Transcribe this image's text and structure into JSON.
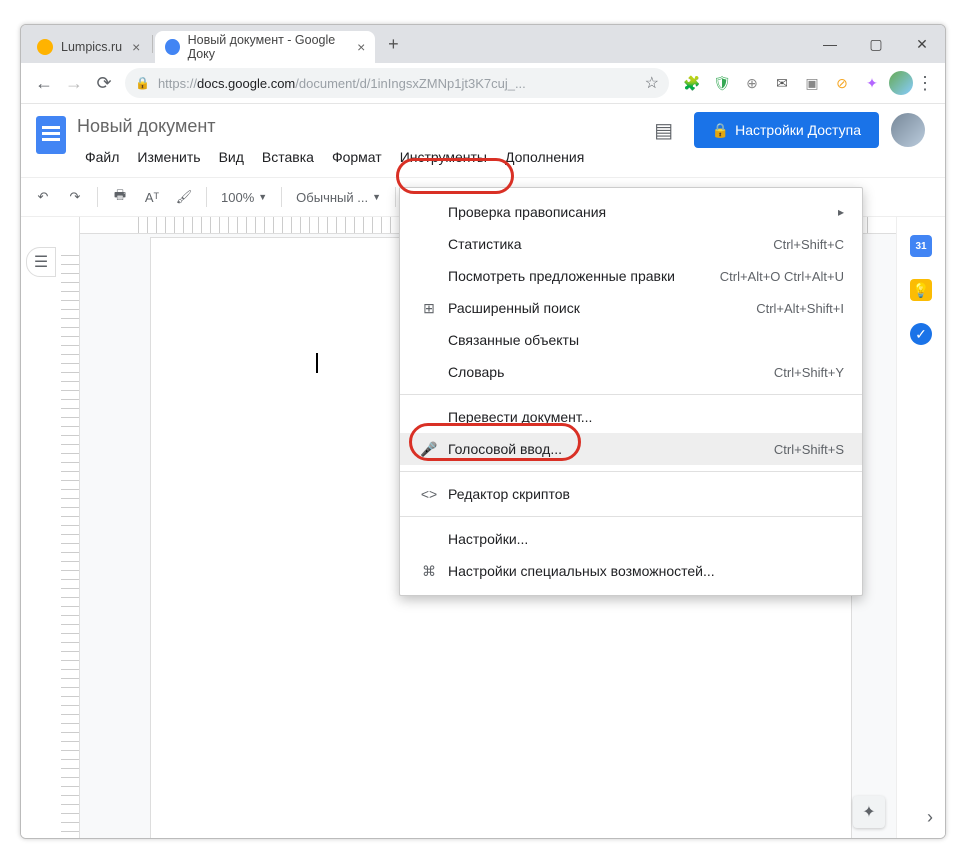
{
  "browser": {
    "tabs": [
      {
        "title": "Lumpics.ru",
        "icon_color": "#ffb300",
        "active": false
      },
      {
        "title": "Новый документ - Google Доку",
        "icon_color": "#4285f4",
        "active": true
      }
    ],
    "url_https": "https://",
    "url_host": "docs.google.com",
    "url_path": "/document/d/1inIngsxZMNp1jt3K7cuj_...",
    "address_buttons": {
      "back": "←",
      "forward": "→",
      "reload": "⟳"
    },
    "extensions": [
      "🧩",
      "🛡",
      "⊕",
      "✉",
      "▣",
      "⊘",
      "✦"
    ]
  },
  "docs": {
    "title": "Новый документ",
    "menus": [
      "Файл",
      "Изменить",
      "Вид",
      "Вставка",
      "Формат",
      "Инструменты",
      "Дополнения"
    ],
    "highlighted_menu_index": 5,
    "share_label": "Настройки Доступа",
    "toolbar": {
      "zoom": "100%",
      "style": "Обычный ..."
    }
  },
  "sidebar": {
    "calendar": "31"
  },
  "dropdown": {
    "items": [
      {
        "icon": "",
        "label": "Проверка правописания",
        "shortcut": "",
        "arrow": true
      },
      {
        "icon": "",
        "label": "Статистика",
        "shortcut": "Ctrl+Shift+C"
      },
      {
        "icon": "",
        "label": "Посмотреть предложенные правки",
        "shortcut": "Ctrl+Alt+O Ctrl+Alt+U"
      },
      {
        "icon": "⊞",
        "label": "Расширенный поиск",
        "shortcut": "Ctrl+Alt+Shift+I"
      },
      {
        "icon": "",
        "label": "Связанные объекты",
        "shortcut": ""
      },
      {
        "icon": "",
        "label": "Словарь",
        "shortcut": "Ctrl+Shift+Y"
      },
      {
        "sep": true
      },
      {
        "icon": "",
        "label": "Перевести документ...",
        "shortcut": ""
      },
      {
        "icon": "🎤",
        "label": "Голосовой ввод...",
        "shortcut": "Ctrl+Shift+S",
        "hover": true
      },
      {
        "sep": true
      },
      {
        "icon": "<>",
        "label": "Редактор скриптов",
        "shortcut": ""
      },
      {
        "sep": true
      },
      {
        "icon": "",
        "label": "Настройки...",
        "shortcut": ""
      },
      {
        "icon": "⌘",
        "label": "Настройки специальных возможностей...",
        "shortcut": ""
      }
    ]
  }
}
